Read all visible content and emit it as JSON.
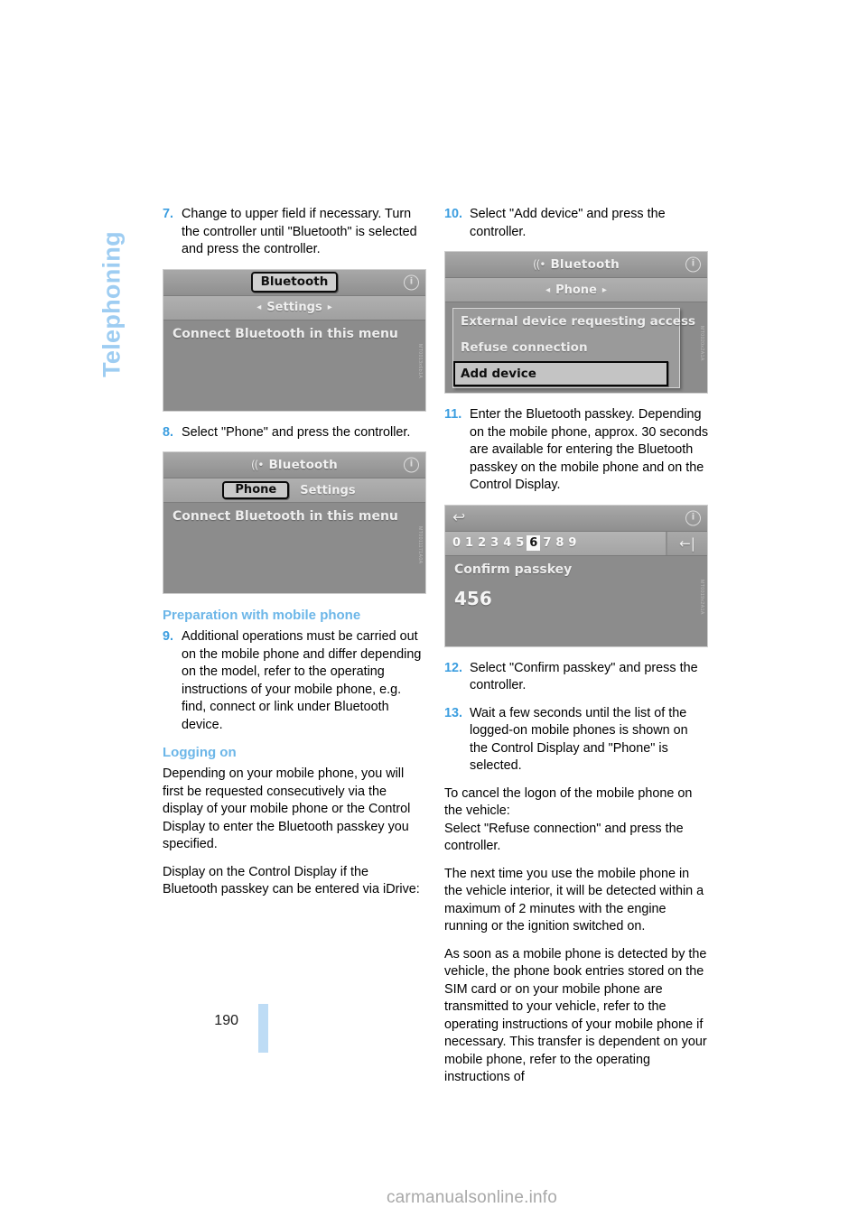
{
  "chapter": {
    "title": "Telephoning"
  },
  "page": {
    "number": "190"
  },
  "watermark": {
    "text": "carmanualsonline.info"
  },
  "left_column": {
    "step7": {
      "num": "7.",
      "text": "Change to upper field if necessary. Turn the controller until \"Bluetooth\" is selected and press the controller."
    },
    "shot1": {
      "titlebar": {
        "selected_label": "Bluetooth",
        "info_icon": "i"
      },
      "breadcrumb": {
        "left_arrow": "◂",
        "label": "Settings",
        "right_arrow": "▸"
      },
      "body_line": "Connect Bluetooth in this menu",
      "ref_code": "MT0013x6b1A"
    },
    "step8": {
      "num": "8.",
      "text": "Select \"Phone\" and press the controller."
    },
    "shot2": {
      "titlebar": {
        "bt_icon": "((•",
        "label": "Bluetooth",
        "info_icon": "i"
      },
      "tabs": [
        {
          "label": "Phone",
          "active": true
        },
        {
          "label": "Settings",
          "active": false
        }
      ],
      "body_line": "Connect Bluetooth in this menu",
      "ref_code": "MT0011171A0A"
    },
    "subhead_preparation": "Preparation with mobile phone",
    "step9": {
      "num": "9.",
      "text": "Additional operations must be carried out on the mobile phone and differ depending on the model, refer to the operating instructions of your mobile phone, e.g. find, connect or link under Bluetooth device."
    },
    "subhead_logging_on": "Logging on",
    "para1": "Depending on your mobile phone, you will first be requested consecutively via the display of your mobile phone or the Control Display to enter the Bluetooth passkey you specified.",
    "para2": "Display on the Control Display if the Bluetooth passkey can be entered via iDrive:"
  },
  "right_column": {
    "step10": {
      "num": "10.",
      "text": "Select \"Add device\" and press the controller."
    },
    "shot3": {
      "titlebar": {
        "bt_icon": "((•",
        "label": "Bluetooth",
        "info_icon": "i"
      },
      "breadcrumb": {
        "left_arrow": "◂",
        "label": "Phone",
        "right_arrow": "▸"
      },
      "popup_items": [
        {
          "label": "External device requesting access",
          "selected": false
        },
        {
          "label": "Refuse connection",
          "selected": false
        },
        {
          "label": "Add device",
          "selected": true
        }
      ],
      "ref_code": "MT0020x2A1A"
    },
    "step11": {
      "num": "11.",
      "text": "Enter the Bluetooth passkey. Depending on the mobile phone, approx. 30 seconds are available for entering the Bluetooth passkey on the mobile phone and on the Control Display."
    },
    "shot4": {
      "titlebar": {
        "back_icon": "↩",
        "info_icon": "i"
      },
      "digits": [
        "0",
        "1",
        "2",
        "3",
        "4",
        "5",
        "6",
        "7",
        "8",
        "9"
      ],
      "current_digit": "6",
      "backspace_icon": "←|",
      "body_line": "Confirm passkey",
      "passkey_value": "456",
      "ref_code": "MT0019x2A1A"
    },
    "step12": {
      "num": "12.",
      "text": "Select \"Confirm passkey\" and press the controller."
    },
    "step13": {
      "num": "13.",
      "text": "Wait a few seconds until the list of the logged-on mobile phones is shown on the Control Display and \"Phone\" is selected."
    },
    "para1": "To cancel the logon of the mobile phone on the vehicle:",
    "para2": "Select \"Refuse connection\" and press the controller.",
    "para3": "The next time you use the mobile phone in the vehicle interior, it will be detected within a maximum of 2 minutes with the engine running or the ignition switched on.",
    "para4": "As soon as a mobile phone is detected by the vehicle, the phone book entries stored on the SIM card or on your mobile phone are transmitted to your vehicle, refer to the operating instructions of your mobile phone if necessary. This transfer is dependent on your mobile phone, refer to the operating instructions of"
  }
}
